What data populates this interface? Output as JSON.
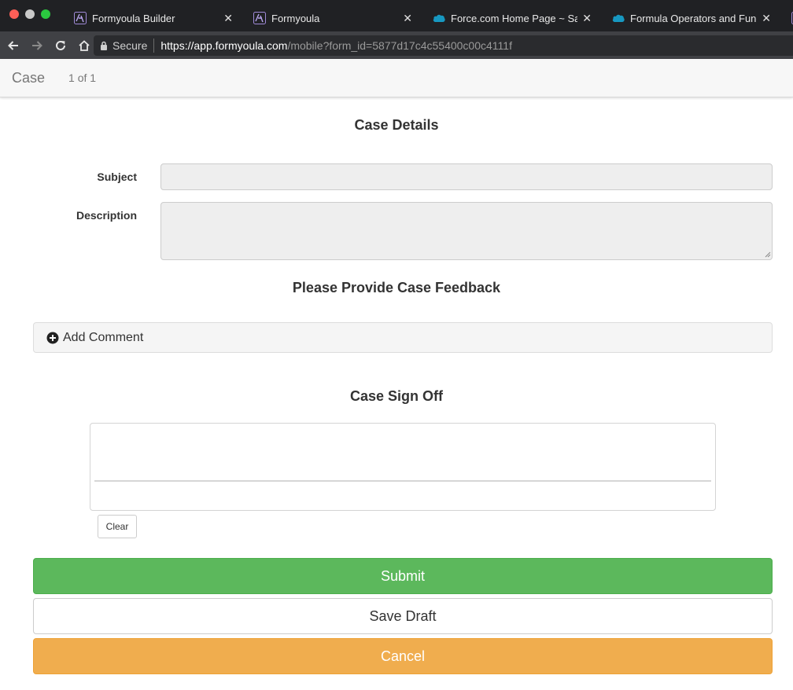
{
  "browser": {
    "tabs": [
      {
        "title": "Formyoula Builder",
        "icon": "formyoula-icon",
        "active": false
      },
      {
        "title": "Formyoula",
        "icon": "formyoula-icon",
        "active": true
      },
      {
        "title": "Force.com Home Page ~ Salesforce",
        "icon": "salesforce-cloud-icon",
        "active": false
      },
      {
        "title": "Formula Operators and Functions",
        "icon": "salesforce-cloud-icon",
        "active": false
      }
    ],
    "secure_label": "Secure",
    "url_host": "https://app.formyoula.com",
    "url_path": "/mobile?form_id=5877d17c4c55400c00c4111f"
  },
  "header": {
    "title": "Case",
    "pager": "1 of 1"
  },
  "form": {
    "section_case_details": "Case Details",
    "subject_label": "Subject",
    "subject_value": "",
    "description_label": "Description",
    "description_value": "",
    "section_feedback": "Please Provide Case Feedback",
    "add_comment_label": "Add Comment",
    "section_sign_off": "Case Sign Off",
    "clear_label": "Clear",
    "submit_label": "Submit",
    "save_draft_label": "Save Draft",
    "cancel_label": "Cancel"
  },
  "colors": {
    "submit": "#5cb85c",
    "cancel": "#f0ad4e",
    "chrome_dark": "#202124"
  }
}
